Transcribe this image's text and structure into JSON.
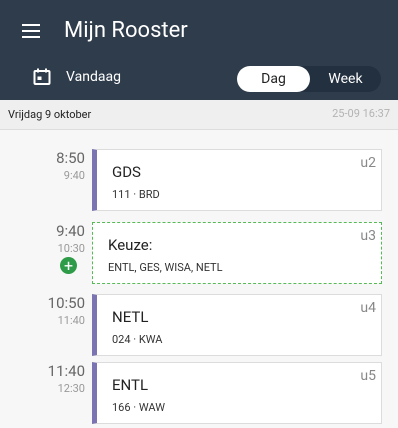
{
  "header": {
    "title": "Mijn Rooster",
    "today": "Vandaag",
    "view_options": [
      "Dag",
      "Week"
    ]
  },
  "date_bar": {
    "date": "Vrijdag 9 oktober",
    "updated": "25-09 16:37"
  },
  "lessons": [
    {
      "start": "8:50",
      "end": "9:40",
      "subject": "GDS",
      "meta": "111 · BRD",
      "slot": "u2"
    },
    {
      "start": "9:40",
      "end": "10:30",
      "subject": "Keuze:",
      "meta": "ENTL, GES, WISA, NETL",
      "slot": "u3"
    },
    {
      "start": "10:50",
      "end": "11:40",
      "subject": "NETL",
      "meta": "024 · KWA",
      "slot": "u4"
    },
    {
      "start": "11:40",
      "end": "12:30",
      "subject": "ENTL",
      "meta": "166 · WAW",
      "slot": "u5"
    }
  ],
  "colors": {
    "appbar": "#2f3c4b",
    "lesson_accent": "#7a74b3",
    "choice_border": "#55bb55",
    "add_button": "#2e9b48"
  },
  "icons": [
    "menu-icon",
    "calendar-icon",
    "plus-icon"
  ]
}
